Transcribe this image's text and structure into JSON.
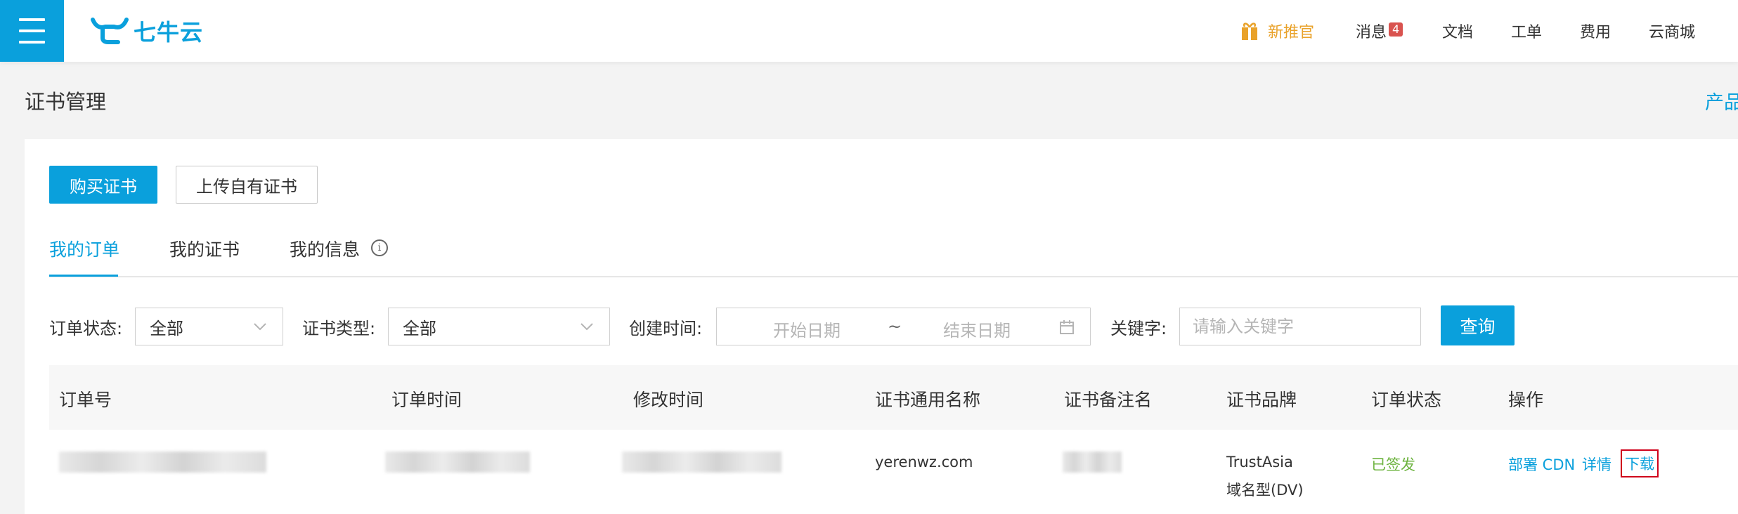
{
  "header": {
    "logo_text": "七牛云",
    "nav": {
      "gift_label": "新推官",
      "messages_label": "消息",
      "messages_count": "4",
      "docs_label": "文档",
      "tickets_label": "工单",
      "billing_label": "费用",
      "store_label": "云商城"
    }
  },
  "page": {
    "title": "证书管理",
    "product_link": "产品"
  },
  "actions": {
    "buy_label": "购买证书",
    "upload_label": "上传自有证书"
  },
  "tabs": [
    {
      "label": "我的订单",
      "active": true
    },
    {
      "label": "我的证书",
      "active": false
    },
    {
      "label": "我的信息",
      "active": false
    }
  ],
  "filters": {
    "status_label": "订单状态:",
    "status_value": "全部",
    "type_label": "证书类型:",
    "type_value": "全部",
    "created_label": "创建时间:",
    "start_placeholder": "开始日期",
    "range_sep": "~",
    "end_placeholder": "结束日期",
    "keyword_label": "关键字:",
    "keyword_placeholder": "请输入关键字",
    "query_label": "查询"
  },
  "table": {
    "columns": [
      "订单号",
      "订单时间",
      "修改时间",
      "证书通用名称",
      "证书备注名",
      "证书品牌",
      "订单状态",
      "操作"
    ],
    "rows": [
      {
        "common_name": "yerenwz.com",
        "brand_line1": "TrustAsia",
        "brand_line2": "域名型(DV)",
        "status": "已签发",
        "op_deploy": "部署 CDN",
        "op_detail": "详情",
        "op_download": "下载"
      }
    ]
  },
  "colors": {
    "accent": "#0aa0dc",
    "gift": "#e9a22a",
    "badge": "#d9534f",
    "success": "#6db33f",
    "highlight_box": "#d0021b"
  }
}
